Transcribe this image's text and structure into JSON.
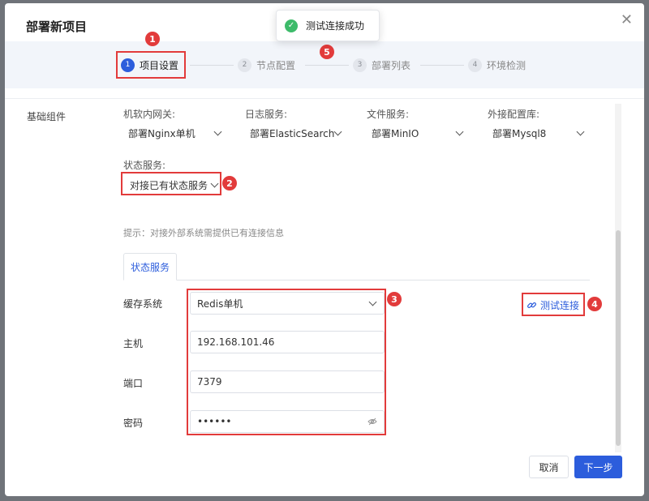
{
  "dialog": {
    "title": "部署新项目",
    "close_glyph": "✕"
  },
  "toast": {
    "message": "测试连接成功"
  },
  "steps": [
    {
      "num": "1",
      "label": "项目设置"
    },
    {
      "num": "2",
      "label": "节点配置"
    },
    {
      "num": "3",
      "label": "部署列表"
    },
    {
      "num": "4",
      "label": "环境检测"
    }
  ],
  "markers": [
    "1",
    "2",
    "3",
    "4",
    "5"
  ],
  "section": {
    "label": "基础组件"
  },
  "components": [
    {
      "label": "机软内网关:",
      "value": "部署Nginx单机"
    },
    {
      "label": "日志服务:",
      "value": "部署ElasticSearch"
    },
    {
      "label": "文件服务:",
      "value": "部署MinIO"
    },
    {
      "label": "外接配置库:",
      "value": "部署Mysql8"
    }
  ],
  "state_service": {
    "label": "状态服务:",
    "value": "对接已有状态服务"
  },
  "hint": "提示：对接外部系统需提供已有连接信息",
  "tab": {
    "label": "状态服务"
  },
  "form": {
    "cache_label": "缓存系统",
    "cache_value": "Redis单机",
    "host_label": "主机",
    "host_value": "192.168.101.46",
    "port_label": "端口",
    "port_value": "7379",
    "password_label": "密码",
    "password_value": "••••••"
  },
  "test_button": "测试连接",
  "footer": {
    "cancel": "取消",
    "next": "下一步"
  },
  "colors": {
    "primary": "#2c5ddc",
    "success": "#3dbb6a",
    "annotation": "#e23b3b"
  },
  "icons": {
    "toast": "check-circle-icon",
    "test": "link-icon",
    "password": "eye-off-icon",
    "close": "close-icon"
  }
}
